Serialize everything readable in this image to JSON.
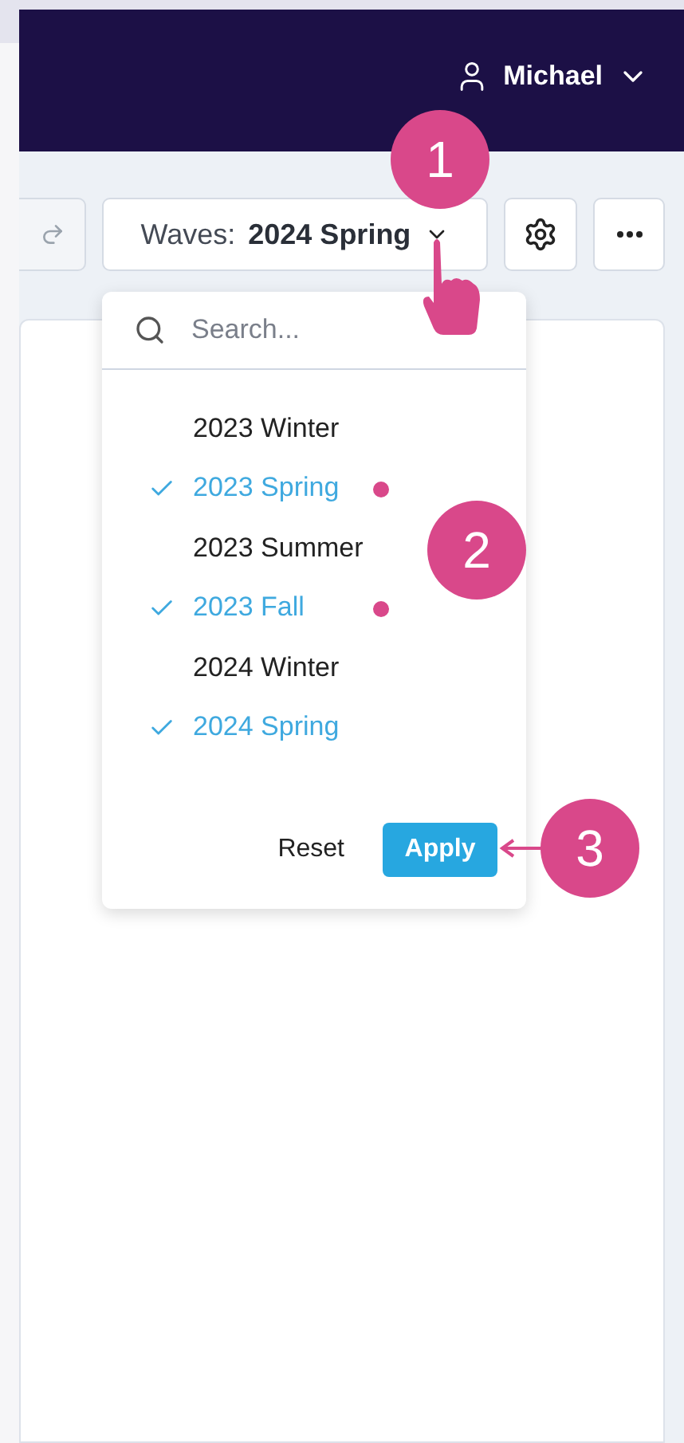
{
  "user": {
    "name": "Michael"
  },
  "toolbar": {
    "waves_label": "Waves:",
    "waves_value": "2024 Spring"
  },
  "dropdown": {
    "search": {
      "placeholder": "Search..."
    },
    "items": [
      {
        "label": "2023 Winter",
        "checked": false,
        "marked": false
      },
      {
        "label": "2023 Spring",
        "checked": true,
        "marked": true
      },
      {
        "label": "2023 Summer",
        "checked": false,
        "marked": false
      },
      {
        "label": "2023 Fall",
        "checked": true,
        "marked": true
      },
      {
        "label": "2024 Winter",
        "checked": false,
        "marked": false
      },
      {
        "label": "2024 Spring",
        "checked": true,
        "marked": false
      }
    ],
    "buttons": {
      "reset": "Reset",
      "apply": "Apply"
    }
  },
  "annotations": [
    {
      "number": "1"
    },
    {
      "number": "2"
    },
    {
      "number": "3"
    }
  ]
}
